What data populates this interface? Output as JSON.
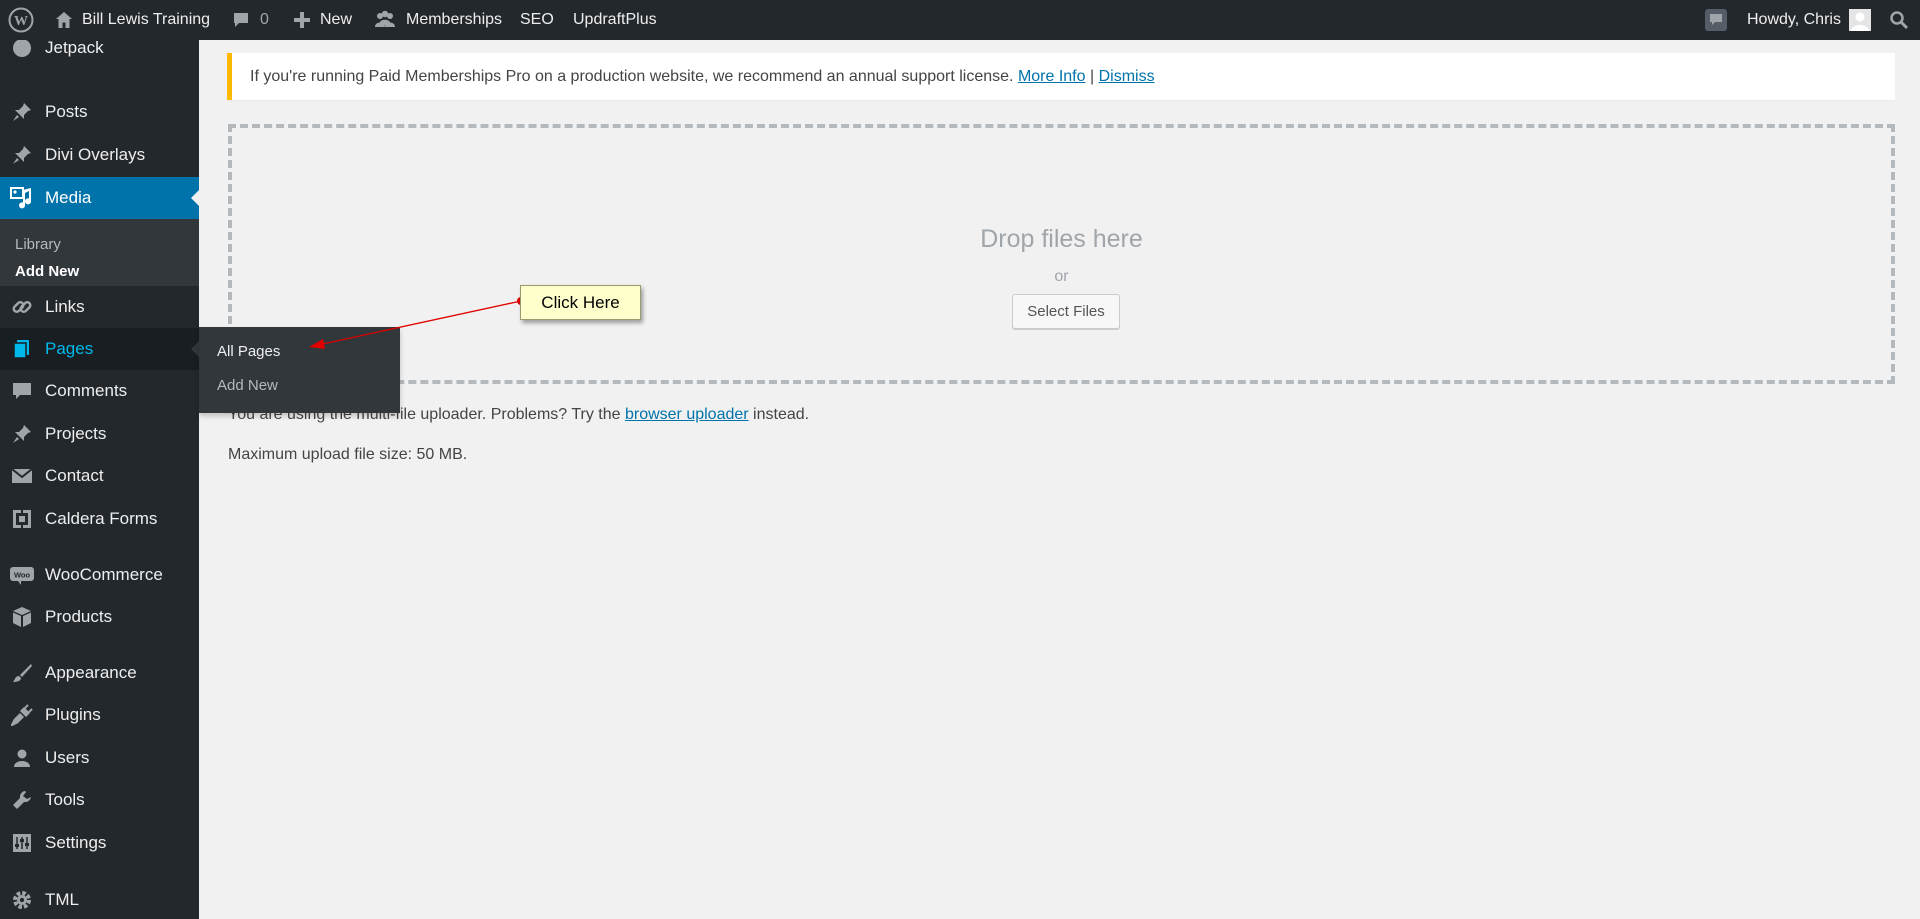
{
  "adminbar": {
    "site_name": "Bill Lewis Training",
    "comments_count": "0",
    "new_label": "New",
    "memberships_label": "Memberships",
    "seo_label": "SEO",
    "updraft_label": "UpdraftPlus",
    "howdy": "Howdy, Chris"
  },
  "sidebar": {
    "partial_top_label": "Jetpack",
    "items": [
      {
        "label": "Posts",
        "icon": "pin-icon"
      },
      {
        "label": "Divi Overlays",
        "icon": "pin-icon"
      },
      {
        "label": "Media",
        "icon": "media-icon"
      },
      {
        "label": "Links",
        "icon": "link-icon"
      },
      {
        "label": "Pages",
        "icon": "pages-icon"
      },
      {
        "label": "Comments",
        "icon": "comment-icon"
      },
      {
        "label": "Projects",
        "icon": "pin-icon"
      },
      {
        "label": "Contact",
        "icon": "mail-icon"
      },
      {
        "label": "Caldera Forms",
        "icon": "caldera-icon"
      },
      {
        "label": "WooCommerce",
        "icon": "woo-icon"
      },
      {
        "label": "Products",
        "icon": "box-icon"
      },
      {
        "label": "Appearance",
        "icon": "brush-icon"
      },
      {
        "label": "Plugins",
        "icon": "plug-icon"
      },
      {
        "label": "Users",
        "icon": "user-icon"
      },
      {
        "label": "Tools",
        "icon": "wrench-icon"
      },
      {
        "label": "Settings",
        "icon": "settings-icon"
      },
      {
        "label": "TML",
        "icon": "gear-icon"
      }
    ],
    "media_submenu": [
      "Library",
      "Add New"
    ]
  },
  "flyout": {
    "items": [
      "All Pages",
      "Add New"
    ]
  },
  "notice": {
    "text": "If you're running Paid Memberships Pro on a production website, we recommend an annual support license.",
    "more_info": "More Info",
    "separator": "|",
    "dismiss": "Dismiss"
  },
  "uploader": {
    "drop_title": "Drop files here",
    "or": "or",
    "select_button": "Select Files",
    "multi_text_before": "You are using the multi-file uploader. Problems? Try the",
    "browser_uploader_link": "browser uploader",
    "multi_text_after": "instead.",
    "max_size": "Maximum upload file size: 50 MB."
  },
  "callout": {
    "text": "Click Here",
    "color": "#ffffcc",
    "arrow_color": "#e00000"
  }
}
